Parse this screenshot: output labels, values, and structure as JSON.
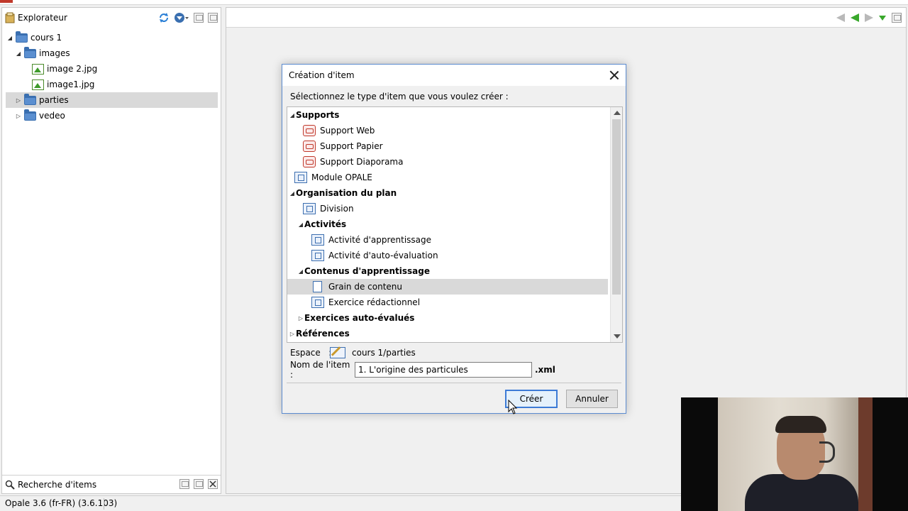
{
  "explorer": {
    "title": "Explorateur",
    "tree": [
      {
        "label": "cours 1",
        "type": "folder",
        "expanded": true
      },
      {
        "label": "images",
        "type": "folder",
        "expanded": true
      },
      {
        "label": "image 2.jpg",
        "type": "image"
      },
      {
        "label": "image1.jpg",
        "type": "image"
      },
      {
        "label": "parties",
        "type": "folder",
        "expanded": false,
        "selected": true
      },
      {
        "label": "vedeo",
        "type": "folder",
        "expanded": false
      }
    ],
    "search_title": "Recherche d'items"
  },
  "status_bar": {
    "text": "Opale 3.6 (fr-FR) (3.6.103)"
  },
  "dialog": {
    "title": "Création d'item",
    "prompt": "Sélectionnez le type d'item que vous voulez créer :",
    "items": [
      {
        "label": "Supports",
        "group": true,
        "expanded": true
      },
      {
        "label": "Support Web",
        "icon": "support-web-icon"
      },
      {
        "label": "Support Papier",
        "icon": "support-paper-icon"
      },
      {
        "label": "Support Diaporama",
        "icon": "support-slideshow-icon"
      },
      {
        "label": "Module OPALE",
        "icon": "module-icon"
      },
      {
        "label": "Organisation du plan",
        "group": true,
        "expanded": true
      },
      {
        "label": "Division",
        "icon": "division-icon"
      },
      {
        "label": "Activités",
        "group": true,
        "expanded": true
      },
      {
        "label": "Activité d'apprentissage",
        "icon": "learning-activity-icon"
      },
      {
        "label": "Activité d'auto-évaluation",
        "icon": "self-assessment-icon"
      },
      {
        "label": "Contenus d'apprentissage",
        "group": true,
        "expanded": true
      },
      {
        "label": "Grain de contenu",
        "icon": "document-icon",
        "selected": true
      },
      {
        "label": "Exercice rédactionnel",
        "icon": "writing-exercise-icon"
      },
      {
        "label": "Exercices auto-évalués",
        "group": true,
        "expanded": false
      },
      {
        "label": "Références",
        "group": true,
        "expanded": false
      }
    ],
    "space_label": "Espace",
    "space_colon": ":",
    "space_value": "cours 1/parties",
    "name_label": "Nom de l'item :",
    "name_value": "1. L'origine des particules",
    "extension": ".xml",
    "create_label": "Créer",
    "cancel_label": "Annuler"
  },
  "colors": {
    "accent_blue": "#3d7bd6",
    "folder_blue": "#3a6fb0",
    "nav_green": "#39a82c",
    "support_red": "#c0392b",
    "selection_grey": "#d9d9d9"
  }
}
